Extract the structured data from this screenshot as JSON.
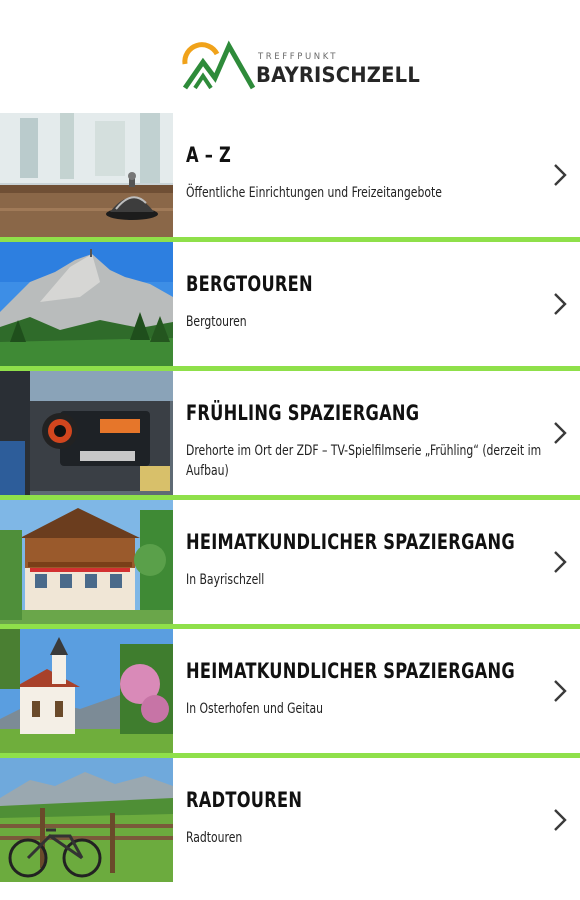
{
  "header": {
    "logo_small": "TREFFPUNKT",
    "logo_big": "BAYRISCHZELL"
  },
  "items": [
    {
      "title": "A – Z",
      "subtitle": "Öffentliche Einrichtungen und Freizeitangebote",
      "image": "reception-bell-image"
    },
    {
      "title": "BERGTOUREN",
      "subtitle": "Bergtouren",
      "image": "mountain-image"
    },
    {
      "title": "FRÜHLING SPAZIERGANG",
      "subtitle": "Drehorte im Ort der ZDF – TV-Spielfilmserie „Frühling“ (derzeit im Aufbau)",
      "image": "film-camera-image"
    },
    {
      "title": "HEIMATKUNDLICHER SPAZIERGANG",
      "subtitle": "In Bayrischzell",
      "image": "alpine-house-image"
    },
    {
      "title": "HEIMATKUNDLICHER SPAZIERGANG",
      "subtitle": "In Osterhofen und Geitau",
      "image": "chapel-image"
    },
    {
      "title": "RADTOUREN",
      "subtitle": "Radtouren",
      "image": "bicycle-meadow-image"
    }
  ],
  "colors": {
    "accent_green": "#8fe04a",
    "logo_orange": "#f0a21a",
    "logo_green": "#2e8b3a",
    "chevron": "#3a3a3a"
  },
  "icons": {
    "row_chevron": "chevron-right-icon"
  }
}
